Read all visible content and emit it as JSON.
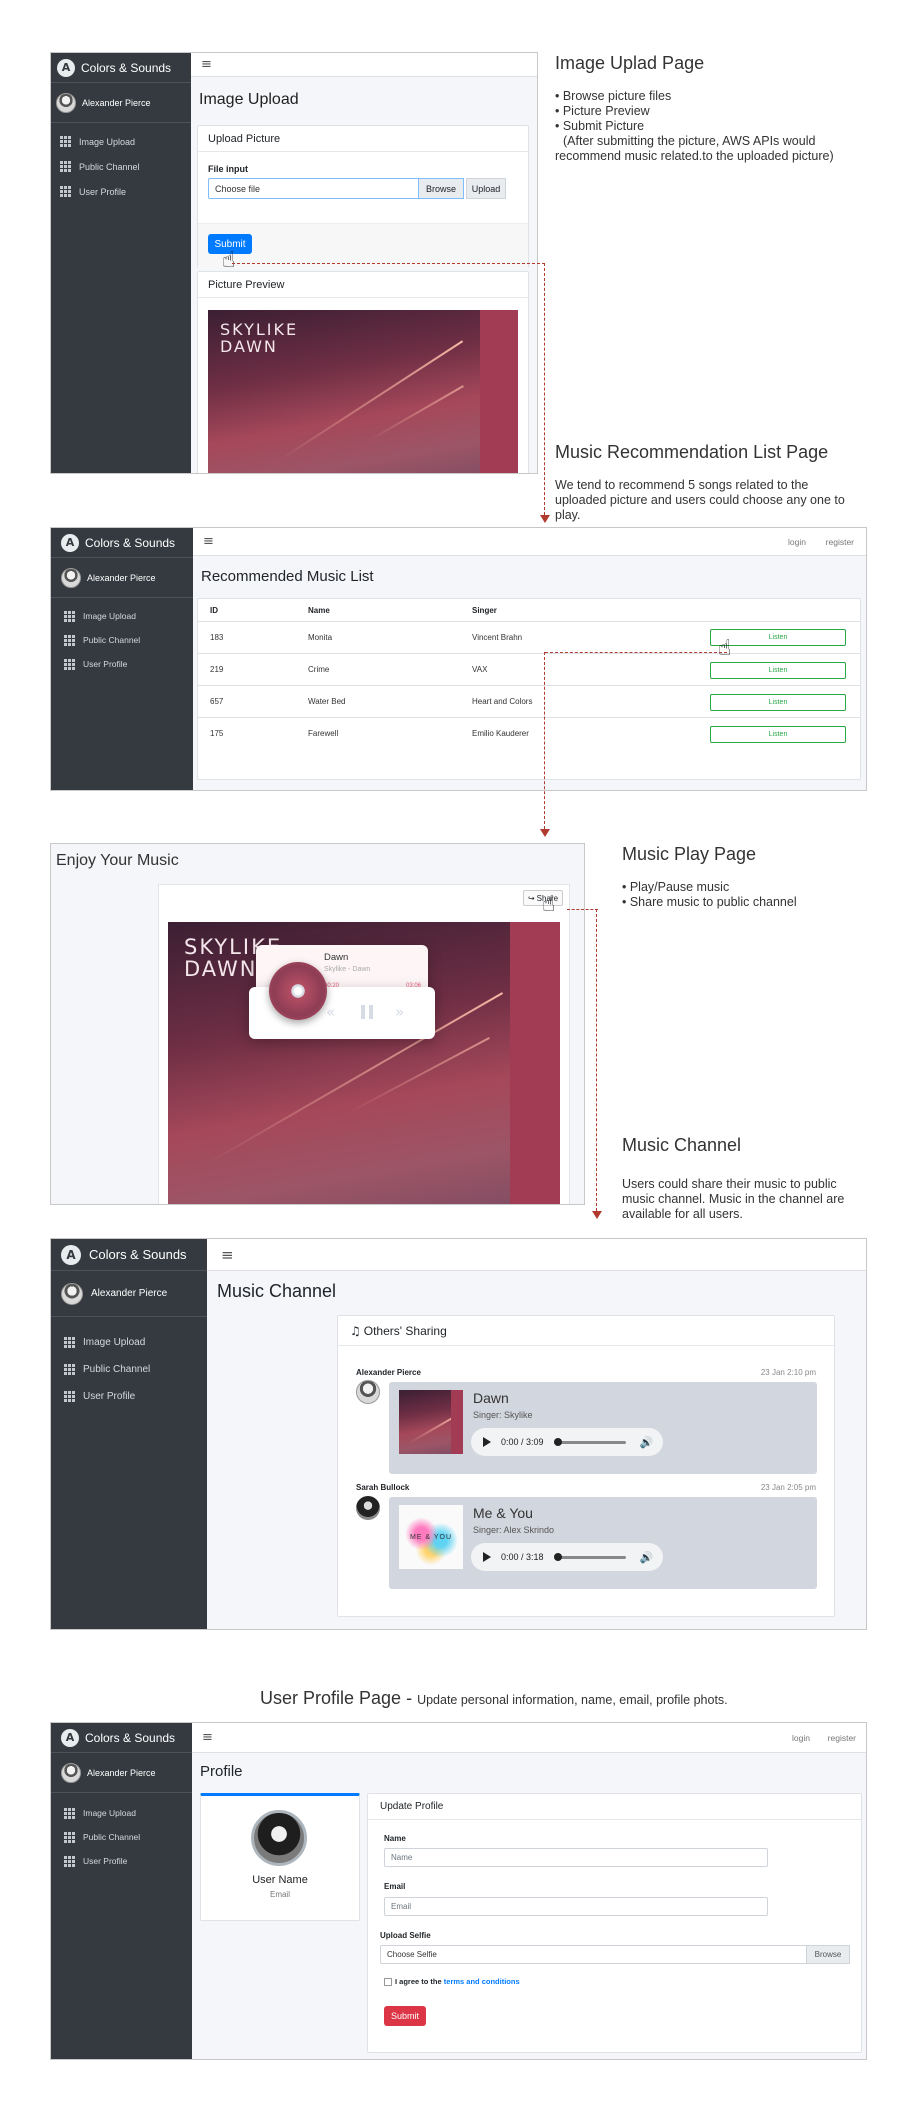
{
  "app": {
    "brand": "Colors & Sounds",
    "brand_logo": "A",
    "user": "Alexander Pierce",
    "nav": [
      "Image Upload",
      "Public Channel",
      "User Profile"
    ],
    "auth": {
      "login": "login",
      "register": "register"
    },
    "hamburger": "≡"
  },
  "upload_page": {
    "title": "Image Upload",
    "card_title": "Upload Picture",
    "file_label": "File input",
    "file_placeholder": "Choose file",
    "browse": "Browse",
    "upload": "Upload",
    "submit": "Submit",
    "preview_title": "Picture Preview",
    "cover_title_1": "SKYLIKE",
    "cover_title_2": "DAWN"
  },
  "upload_note": {
    "heading": "Image Uplad Page",
    "bullets": [
      "• Browse picture files",
      "• Picture Preview",
      "• Submit Picture"
    ],
    "extra_1": "(After submitting the picture, AWS APIs would",
    "extra_2": "recommend music related.to the uploaded picture)"
  },
  "rec_note": {
    "heading": "Music Recommendation List Page",
    "line_1": "We tend to recommend 5 songs related to the",
    "line_2": "uploaded picture and users could choose any one to",
    "line_3": "play."
  },
  "rec_page": {
    "title": "Recommended Music List",
    "columns": [
      "ID",
      "Name",
      "Singer"
    ],
    "rows": [
      {
        "id": "183",
        "name": "Monita",
        "singer": "Vincent Brahn",
        "action": "Listen"
      },
      {
        "id": "219",
        "name": "Crime",
        "singer": "VAX",
        "action": "Listen"
      },
      {
        "id": "657",
        "name": "Water Bed",
        "singer": "Heart and Colors",
        "action": "Listen"
      },
      {
        "id": "175",
        "name": "Farewell",
        "singer": "Emilio Kauderer",
        "action": "Listen"
      }
    ]
  },
  "play_page": {
    "title": "Enjoy Your Music",
    "share": "Share",
    "song": "Dawn",
    "subtitle": "Skylike - Dawn",
    "time_current": "00:20",
    "time_total": "03:06",
    "progress": 0.1
  },
  "play_note": {
    "heading": "Music Play Page",
    "bullets": [
      "• Play/Pause music",
      "• Share music to public channel"
    ]
  },
  "channel_note": {
    "heading": "Music Channel",
    "line_1": "Users could share their music to public",
    "line_2": "music channel. Music in the channel are",
    "line_3": "available for all users."
  },
  "channel_page": {
    "title": "Music Channel",
    "card_title": "Others' Sharing",
    "posts": [
      {
        "user": "Alexander Pierce",
        "time": "23 Jan 2:10 pm",
        "song": "Dawn",
        "singer": "Singer: Skylike",
        "audio": "0:00 / 3:09"
      },
      {
        "user": "Sarah Bullock",
        "time": "23 Jan 2:05 pm",
        "song": "Me & You",
        "singer": "Singer: Alex Skrindo",
        "audio": "0:00 / 3:18"
      }
    ],
    "me_you_cover_text": "ME & YOU"
  },
  "profile_note": {
    "heading": "User Profile Page - ",
    "detail": "Update personal information, name, email, profile phots."
  },
  "profile_page": {
    "title": "Profile",
    "user_name": "User Name",
    "user_email": "Email",
    "card_title": "Update Profile",
    "name_label": "Name",
    "name_placeholder": "Name",
    "email_label": "Email",
    "email_placeholder": "Email",
    "selfie_label": "Upload Selfie",
    "selfie_placeholder": "Choose Selfie",
    "browse": "Browse",
    "agree_prefix": "I agree to the",
    "agree_link": "terms and conditions",
    "submit": "Submit"
  },
  "colors": {
    "primary": "#007bff",
    "danger": "#dc3545",
    "success": "#28a745",
    "arrow": "#b03a2e",
    "sidebar": "#343a40"
  }
}
